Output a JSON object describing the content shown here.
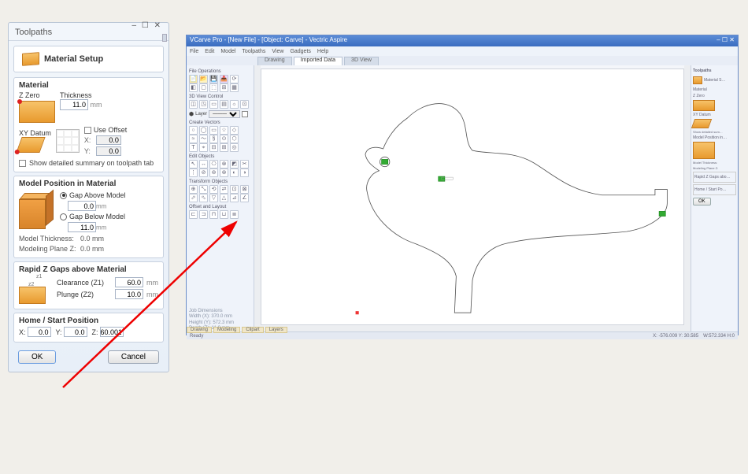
{
  "panel": {
    "tab_label": "Toolpaths",
    "setup_title": "Material Setup",
    "material": {
      "heading": "Material",
      "zzero": "Z Zero",
      "thickness_label": "Thickness",
      "thickness": "11.0",
      "mm": "mm",
      "xy_datum": "XY Datum",
      "use_offset": "Use Offset",
      "x_label": "X:",
      "x": "0.0",
      "y_label": "Y:",
      "y": "0.0",
      "show_detail": "Show detailed summary on toolpath tab"
    },
    "model": {
      "heading": "Model Position in Material",
      "gap_above": "Gap Above Model",
      "gap_above_val": "0.0",
      "gap_below": "Gap Below Model",
      "gap_below_val": "11.0",
      "mm": "mm",
      "thick_label": "Model Thickness:",
      "thick_val": "0.0 mm",
      "plane_label": "Modeling Plane Z:",
      "plane_val": "0.0 mm"
    },
    "rapid": {
      "heading": "Rapid Z Gaps above Material",
      "clearance_label": "Clearance (Z1)",
      "clearance": "60.0",
      "plunge_label": "Plunge (Z2)",
      "plunge": "10.0",
      "mm": "mm"
    },
    "home": {
      "heading": "Home / Start Position",
      "x_label": "X:",
      "x": "0.0",
      "y_label": "Y:",
      "y": "0.0",
      "z_label": "Z:",
      "z": "60.001"
    },
    "buttons": {
      "ok": "OK",
      "cancel": "Cancel"
    }
  },
  "app": {
    "title": "VCarve Pro - [New File] - [Object: Carve] - Vectric Aspire",
    "menu": [
      "File",
      "Edit",
      "Model",
      "Toolpaths",
      "View",
      "Gadgets",
      "Help"
    ],
    "tabs": {
      "t2d": "Drawing",
      "tImport": "Imported Data",
      "t3d": "3D View"
    },
    "left": {
      "fileops": "File Operations",
      "view3d": "3D View Control",
      "layer_lbl": "Layer",
      "createv": "Create Vectors",
      "editobj": "Edit Objects",
      "transform": "Transform Objects",
      "offset": "Offset and Layout"
    },
    "right": {
      "toolpaths": "Toolpaths",
      "matset": "Material S…",
      "material": "Material",
      "zzero": "Z Zero",
      "xydatum": "XY Datum",
      "show": "Show detailed sum…",
      "modelpos": "Model Position in…",
      "modelthk": "Model Thickness:",
      "modelplane": "Modeling Plane Z:",
      "rapid": "Rapid Z Gaps abo…",
      "home": "Home / Start Po…",
      "ok": "OK"
    },
    "jobdims": {
      "title": "Job Dimensions",
      "w": "Width (X): 370.0 mm",
      "h": "Height (Y): 572.3 mm",
      "d": "Depth (Z): 11.0 mm"
    },
    "bottom_tabs": [
      "Drawing",
      "Modeling",
      "Clipart",
      "Layers"
    ],
    "status_left": "Ready",
    "status_coords": "X: -576.009 Y: 30.585",
    "status_scale": "W:572.334 H:0"
  }
}
